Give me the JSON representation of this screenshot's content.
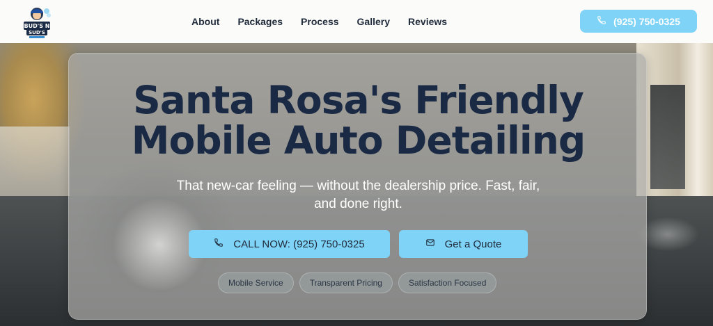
{
  "header": {
    "logo_text": "BUD'S N SUD'S",
    "nav": [
      {
        "label": "About"
      },
      {
        "label": "Packages"
      },
      {
        "label": "Process"
      },
      {
        "label": "Gallery"
      },
      {
        "label": "Reviews"
      }
    ],
    "phone": "(925) 750-0325",
    "phone_icon": "phone-icon"
  },
  "hero": {
    "title_line1": "Santa Rosa's Friendly",
    "title_line2": "Mobile Auto Detailing",
    "subtitle": "That new-car feeling — without the dealership price. Fast, fair, and done right.",
    "cta_call": "CALL NOW: (925) 750-0325",
    "cta_quote": "Get a Quote",
    "pills": [
      "Mobile Service",
      "Transparent Pricing",
      "Satisfaction Focused"
    ]
  },
  "colors": {
    "accent": "#7fd3f7",
    "title": "#1b2a44",
    "nav_text": "#1f2a3a"
  }
}
